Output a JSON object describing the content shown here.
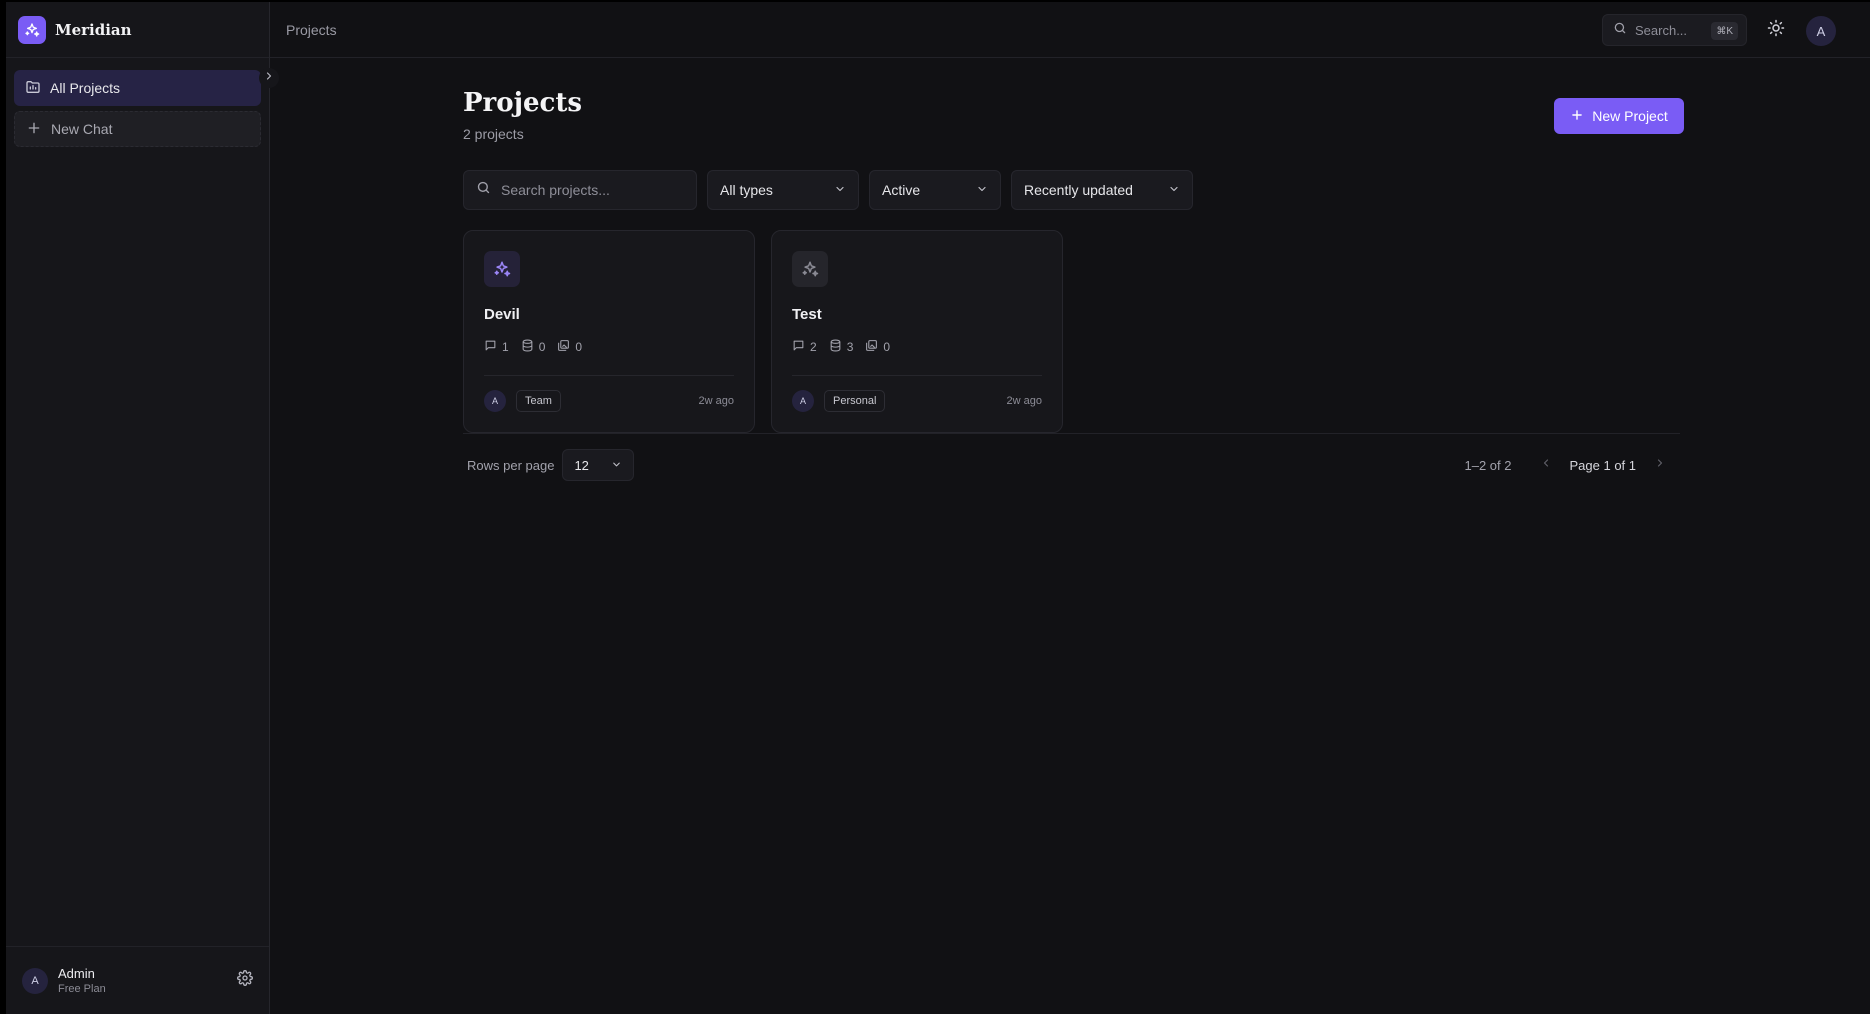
{
  "brand": {
    "name": "Meridian"
  },
  "sidebar": {
    "items": [
      {
        "label": "All Projects",
        "icon": "folder-icon"
      },
      {
        "label": "New Chat",
        "icon": "plus-icon"
      }
    ],
    "user": {
      "name": "Admin",
      "plan": "Free Plan",
      "initial": "A"
    }
  },
  "topbar": {
    "breadcrumb": "Projects",
    "search_placeholder": "Search...",
    "shortcut": "⌘K",
    "avatar_initial": "A"
  },
  "page": {
    "title": "Projects",
    "subtitle": "2 projects",
    "new_button": "New Project"
  },
  "filters": {
    "search_placeholder": "Search projects...",
    "type": "All types",
    "status": "Active",
    "sort": "Recently updated"
  },
  "projects": [
    {
      "name": "Devil",
      "chats": "1",
      "sources": "0",
      "files": "0",
      "owner_initial": "A",
      "tag": "Team",
      "updated": "2w ago"
    },
    {
      "name": "Test",
      "chats": "2",
      "sources": "3",
      "files": "0",
      "owner_initial": "A",
      "tag": "Personal",
      "updated": "2w ago"
    }
  ],
  "pagination": {
    "rows_label": "Rows per page",
    "rows_value": "12",
    "range": "1–2 of 2",
    "page_text": "Page 1 of 1"
  },
  "colors": {
    "accent": "#7a5cf5",
    "background": "#111114",
    "sidebar": "#16161a"
  }
}
